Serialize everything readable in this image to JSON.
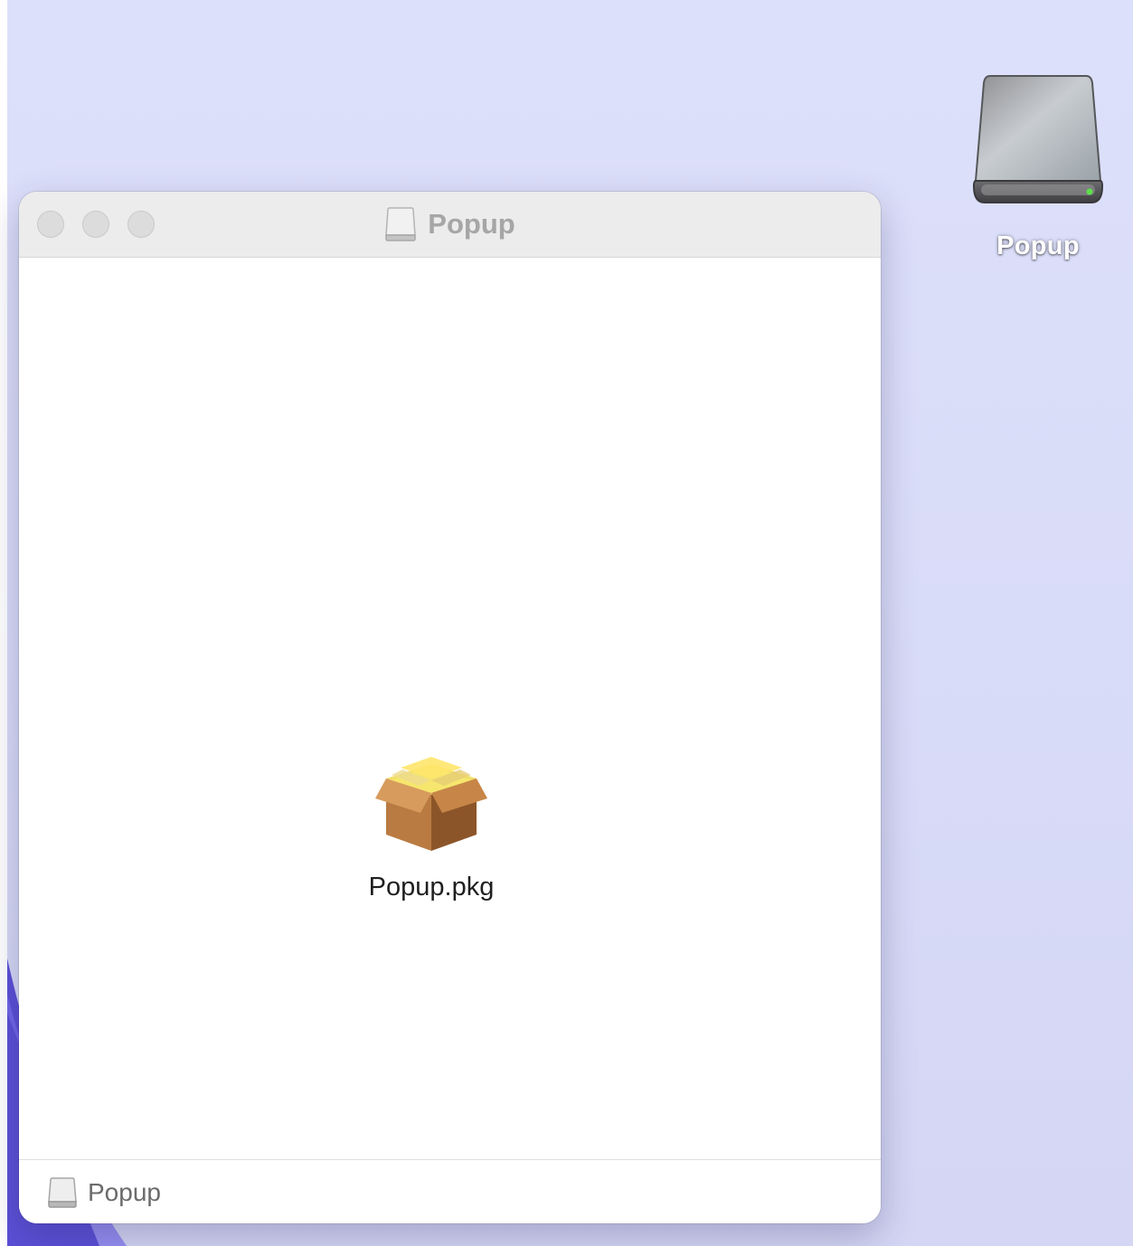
{
  "desktop": {
    "drive_icon": "external-drive-icon",
    "drive_label": "Popup"
  },
  "window": {
    "title": "Popup",
    "title_icon": "drive-icon",
    "traffic_lights": [
      "close",
      "minimize",
      "zoom"
    ],
    "files": [
      {
        "name": "Popup.pkg",
        "icon": "package-icon"
      }
    ],
    "path_bar": {
      "icon": "drive-icon",
      "label": "Popup"
    }
  },
  "colors": {
    "desktop_background": "#dcdff9",
    "window_background": "#ffffff",
    "titlebar": "#ececec",
    "title_text": "#a6a6a6",
    "inactive_traffic_light": "#dcdcdc",
    "drive_led": "#5de04a",
    "box_brown": "#b5773f",
    "box_yellow": "#f0dc5a"
  }
}
